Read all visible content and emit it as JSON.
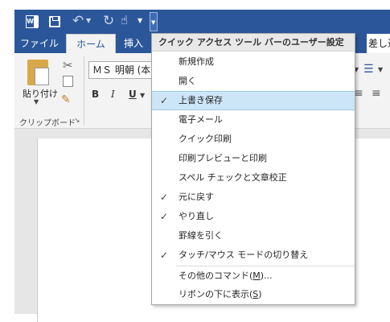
{
  "app": {
    "word_icon_letter": "W"
  },
  "quick_access_toolbar": {
    "icons": [
      "word-app-icon",
      "save-icon",
      "undo-icon",
      "redo-icon",
      "touch-mode-icon",
      "customize-arrow-icon"
    ]
  },
  "tabs": [
    {
      "label": "ファイル"
    },
    {
      "label": "ホーム"
    },
    {
      "label": "挿入"
    },
    {
      "label": "差し込"
    }
  ],
  "ribbon": {
    "paste_label": "貼り付け",
    "clipboard_group_label": "クリップボード",
    "font_name": "ＭＳ 明朝 (本",
    "bold": "B",
    "italic": "I",
    "underline": "U"
  },
  "menu": {
    "title": "クイック アクセス ツール バーのユーザー設定",
    "items": [
      {
        "label": "新規作成",
        "checked": false
      },
      {
        "label": "開く",
        "checked": false
      },
      {
        "label": "上書き保存",
        "checked": true,
        "highlighted": true
      },
      {
        "label": "電子メール",
        "checked": false
      },
      {
        "label": "クイック印刷",
        "checked": false
      },
      {
        "label": "印刷プレビューと印刷",
        "checked": false
      },
      {
        "label": "スペル チェックと文章校正",
        "checked": false
      },
      {
        "label": "元に戻す",
        "checked": true
      },
      {
        "label": "やり直し",
        "checked": true
      },
      {
        "label": "罫線を引く",
        "checked": false
      },
      {
        "label": "タッチ/マウス モードの切り替え",
        "checked": true
      }
    ],
    "more_commands": {
      "label_prefix": "その他のコマンド(",
      "accel": "M",
      "label_suffix": ")..."
    },
    "show_below_ribbon": {
      "label_prefix": "リボンの下に表示(",
      "accel": "S",
      "label_suffix": ")"
    },
    "check_glyph": "✓"
  },
  "colors": {
    "word_blue": "#2b579a",
    "ribbon_bg": "#f3f3f3",
    "menu_highlight": "#cde6f7"
  }
}
